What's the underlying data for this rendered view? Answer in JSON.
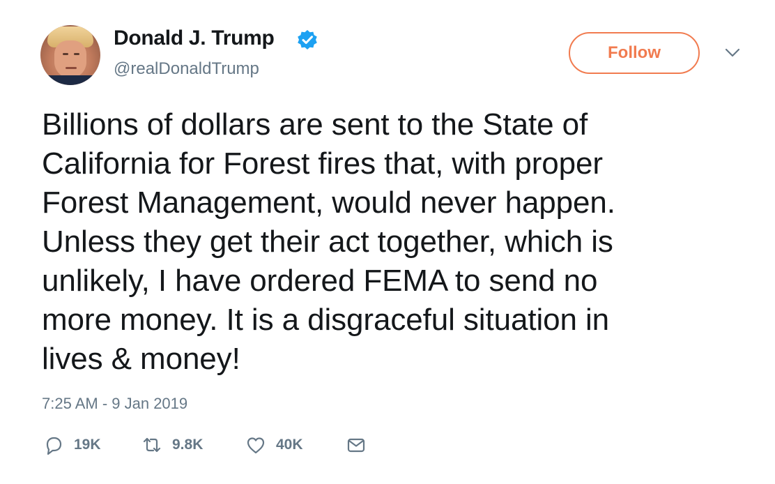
{
  "user": {
    "display_name": "Donald J. Trump",
    "handle": "@realDonaldTrump",
    "verified": true
  },
  "header": {
    "follow_label": "Follow",
    "accent_color": "#f17b4f"
  },
  "tweet": {
    "text": "Billions of dollars are sent to the State of\nCalifornia for Forest fires that, with proper\nForest Management, would never happen.\nUnless they get their act together, which is\nunlikely, I have ordered FEMA to send no\nmore money. It is a disgraceful situation in\nlives & money!",
    "timestamp": "7:25 AM - 9 Jan 2019"
  },
  "actions": {
    "replies": "19K",
    "retweets": "9.8K",
    "likes": "40K",
    "icons": [
      "reply-icon",
      "retweet-icon",
      "like-icon",
      "direct-message-icon"
    ]
  },
  "colors": {
    "text": "#14171a",
    "secondary": "#657786",
    "verified": "#1da1f2"
  }
}
